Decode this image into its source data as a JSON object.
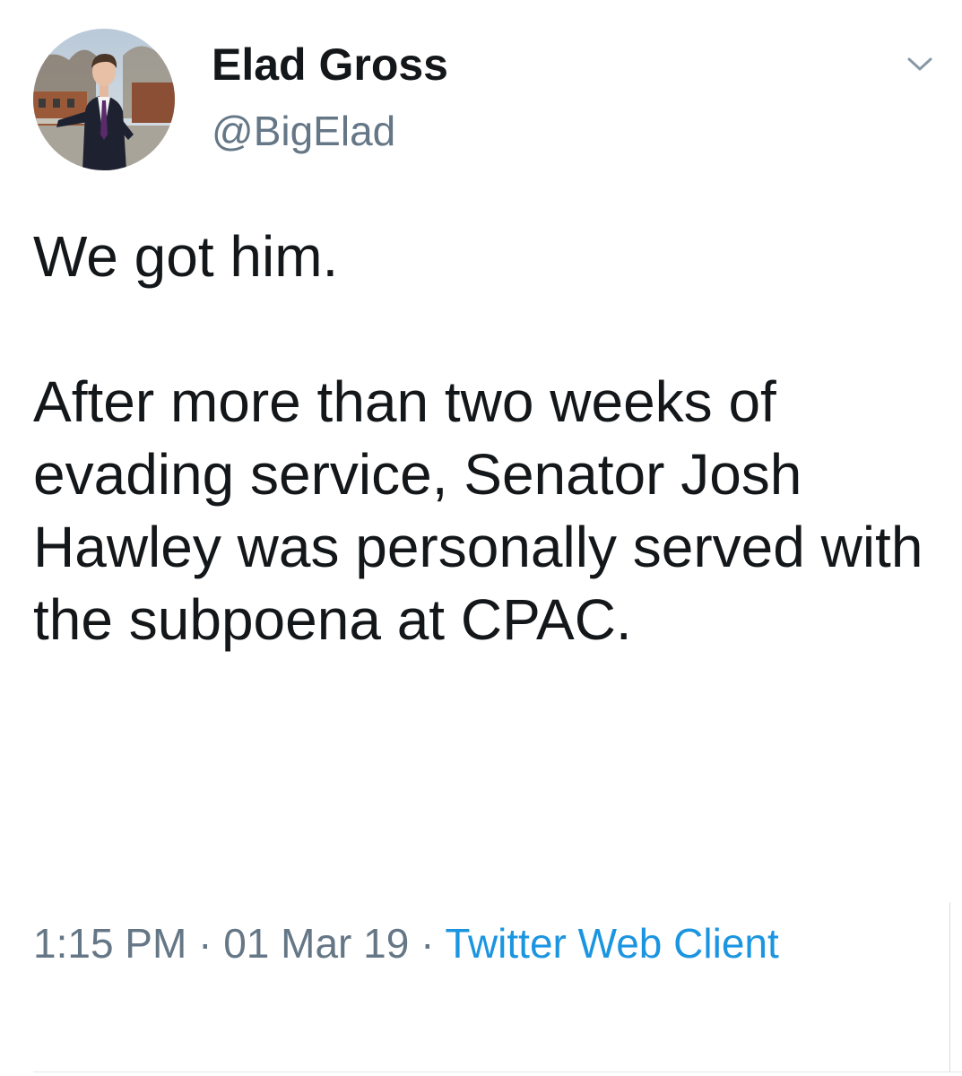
{
  "author": {
    "display_name": "Elad Gross",
    "handle": "@BigElad"
  },
  "icons": {
    "menu": "chevron-down-icon",
    "avatar": "profile-photo"
  },
  "tweet": {
    "text": "We got him.\n\nAfter more than two weeks of evading service, Senator Josh Hawley was personally served with the subpoena at CPAC."
  },
  "meta": {
    "time": "1:15 PM",
    "separator": " · ",
    "date": "01 Mar 19",
    "source": "Twitter Web Client"
  },
  "colors": {
    "text_primary": "#14171a",
    "text_secondary": "#657786",
    "link": "#1b95e0",
    "divider": "#e1e8ed"
  }
}
